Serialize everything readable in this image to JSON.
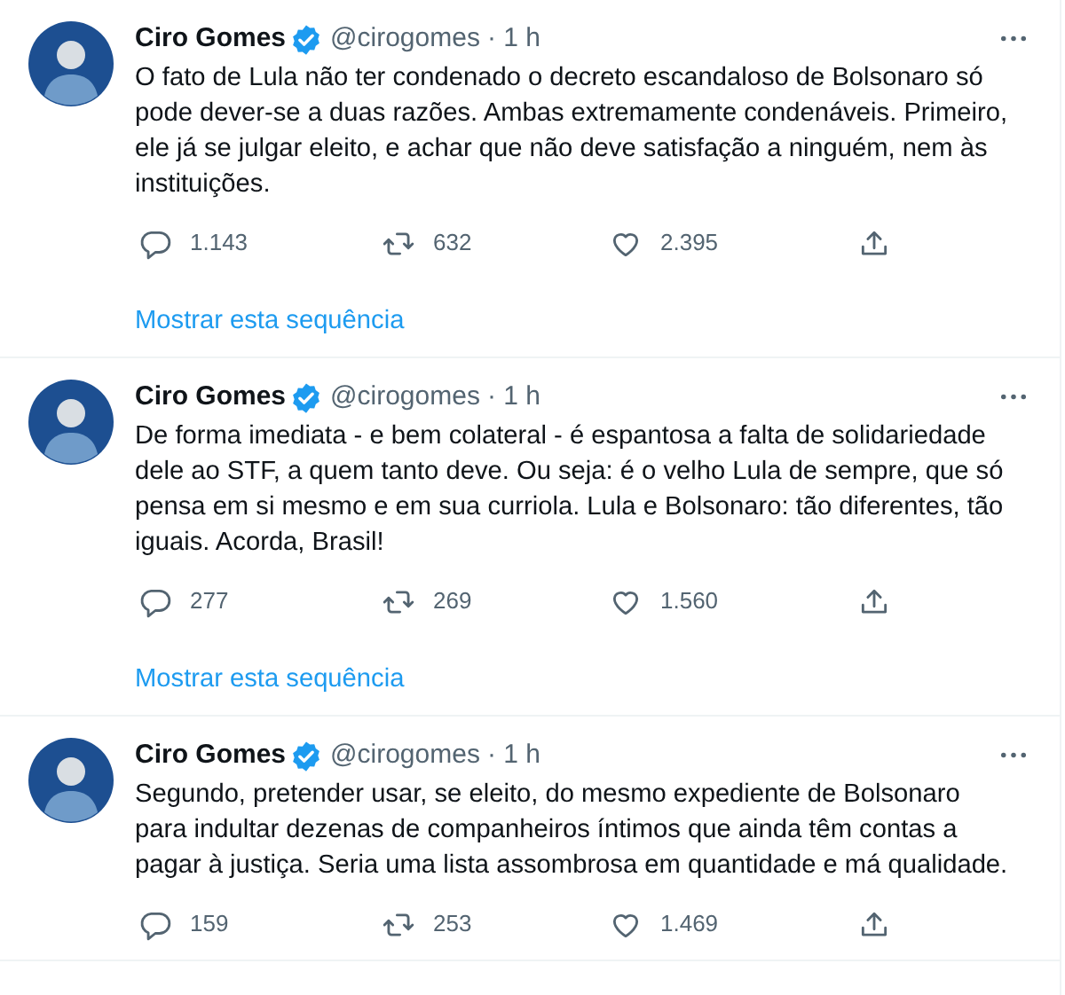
{
  "tweets": [
    {
      "name": "Ciro Gomes",
      "verified": true,
      "handle": "@cirogomes",
      "time": "· 1 h",
      "text": "O fato de Lula não ter condenado o decreto escandaloso de Bolsonaro só pode dever-se a duas razões. Ambas extremamente condenáveis. Primeiro, ele já se julgar eleito, e achar que não deve satisfação a ninguém, nem às instituições.",
      "replies": "1.143",
      "retweets": "632",
      "likes": "2.395",
      "thread_link": "Mostrar esta sequência"
    },
    {
      "name": "Ciro Gomes",
      "verified": true,
      "handle": "@cirogomes",
      "time": "· 1 h",
      "text": "De forma imediata - e bem colateral - é espantosa a falta de solidariedade dele ao STF, a quem tanto deve. Ou seja: é o velho Lula de sempre, que só pensa em si mesmo e em sua curriola. Lula e Bolsonaro: tão diferentes, tão iguais. Acorda, Brasil!",
      "replies": "277",
      "retweets": "269",
      "likes": "1.560",
      "thread_link": "Mostrar esta sequência"
    },
    {
      "name": "Ciro Gomes",
      "verified": true,
      "handle": "@cirogomes",
      "time": "· 1 h",
      "text": "Segundo, pretender usar, se eleito, do mesmo expediente de Bolsonaro para indultar dezenas de companheiros íntimos que ainda têm contas a pagar à justiça. Seria uma lista assombrosa em quantidade e má qualidade.",
      "replies": "159",
      "retweets": "253",
      "likes": "1.469"
    }
  ]
}
